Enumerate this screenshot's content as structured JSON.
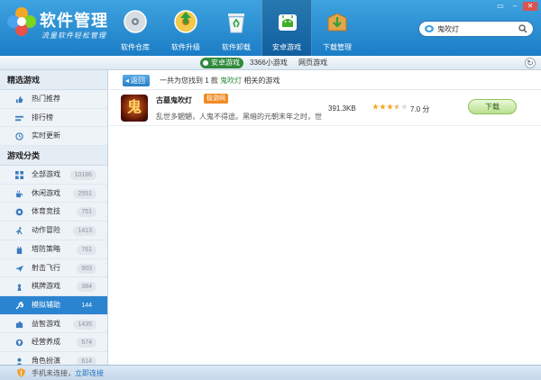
{
  "app": {
    "title": "软件管理",
    "subtitle": "流量软件轻松管理"
  },
  "nav": [
    {
      "label": "软件仓库",
      "icon": "disc-icon"
    },
    {
      "label": "软件升级",
      "icon": "upgrade-disc-icon"
    },
    {
      "label": "软件卸载",
      "icon": "recycle-bin-icon"
    },
    {
      "label": "安卓游戏",
      "icon": "android-game-icon"
    },
    {
      "label": "下载管理",
      "icon": "download-box-icon"
    }
  ],
  "nav_active": "安卓游戏",
  "search": {
    "value": "鬼吹灯",
    "placeholder": ""
  },
  "subnav": {
    "tabs": [
      "安卓游戏",
      "3366小游戏",
      "网页游戏"
    ],
    "active": "安卓游戏"
  },
  "sidebar": {
    "featured_title": "精选游戏",
    "featured": [
      {
        "label": "热门推荐",
        "icon": "thumbs-up-icon"
      },
      {
        "label": "排行榜",
        "icon": "ranking-icon"
      },
      {
        "label": "实时更新",
        "icon": "clock-icon"
      }
    ],
    "category_title": "游戏分类",
    "categories": [
      {
        "label": "全部游戏",
        "count": "10186",
        "icon": "grid-icon"
      },
      {
        "label": "休闲游戏",
        "count": "2551",
        "icon": "coffee-icon"
      },
      {
        "label": "体育竞技",
        "count": "751",
        "icon": "ball-icon"
      },
      {
        "label": "动作冒险",
        "count": "1413",
        "icon": "running-icon"
      },
      {
        "label": "塔防策略",
        "count": "761",
        "icon": "tower-icon"
      },
      {
        "label": "射击飞行",
        "count": "903",
        "icon": "plane-icon"
      },
      {
        "label": "棋牌游戏",
        "count": "384",
        "icon": "chess-icon"
      },
      {
        "label": "模拟辅助",
        "count": "144",
        "icon": "wrench-icon"
      },
      {
        "label": "益智游戏",
        "count": "1435",
        "icon": "puzzle-icon"
      },
      {
        "label": "经营养成",
        "count": "574",
        "icon": "gem-icon"
      },
      {
        "label": "角色扮演",
        "count": "614",
        "icon": "person-icon"
      }
    ],
    "active": "模拟辅助"
  },
  "results": {
    "back_label": "返回",
    "prefix": "一共为您找到",
    "count": "1",
    "unit": "款",
    "keyword": "鬼吹灯",
    "suffix": "相关的游戏"
  },
  "apps": [
    {
      "icon_char": "鬼",
      "name": "古墓鬼吹灯",
      "tag": "极游网",
      "desc": "乱世多魍魉，人鬼不得途。黑暗的元朝末年之时，世...",
      "size": "391.3KB",
      "rating": 3.5,
      "score": "7.0 分",
      "download_label": "下载"
    }
  ],
  "statusbar": {
    "text": "手机未连接，",
    "link": "立即连接"
  },
  "colors": {
    "header": "#1b7dc6",
    "accent_green": "#2e8a3a",
    "sidebar_active": "#2b84d0",
    "tag_orange": "#f08a24",
    "star": "#f5a623"
  }
}
